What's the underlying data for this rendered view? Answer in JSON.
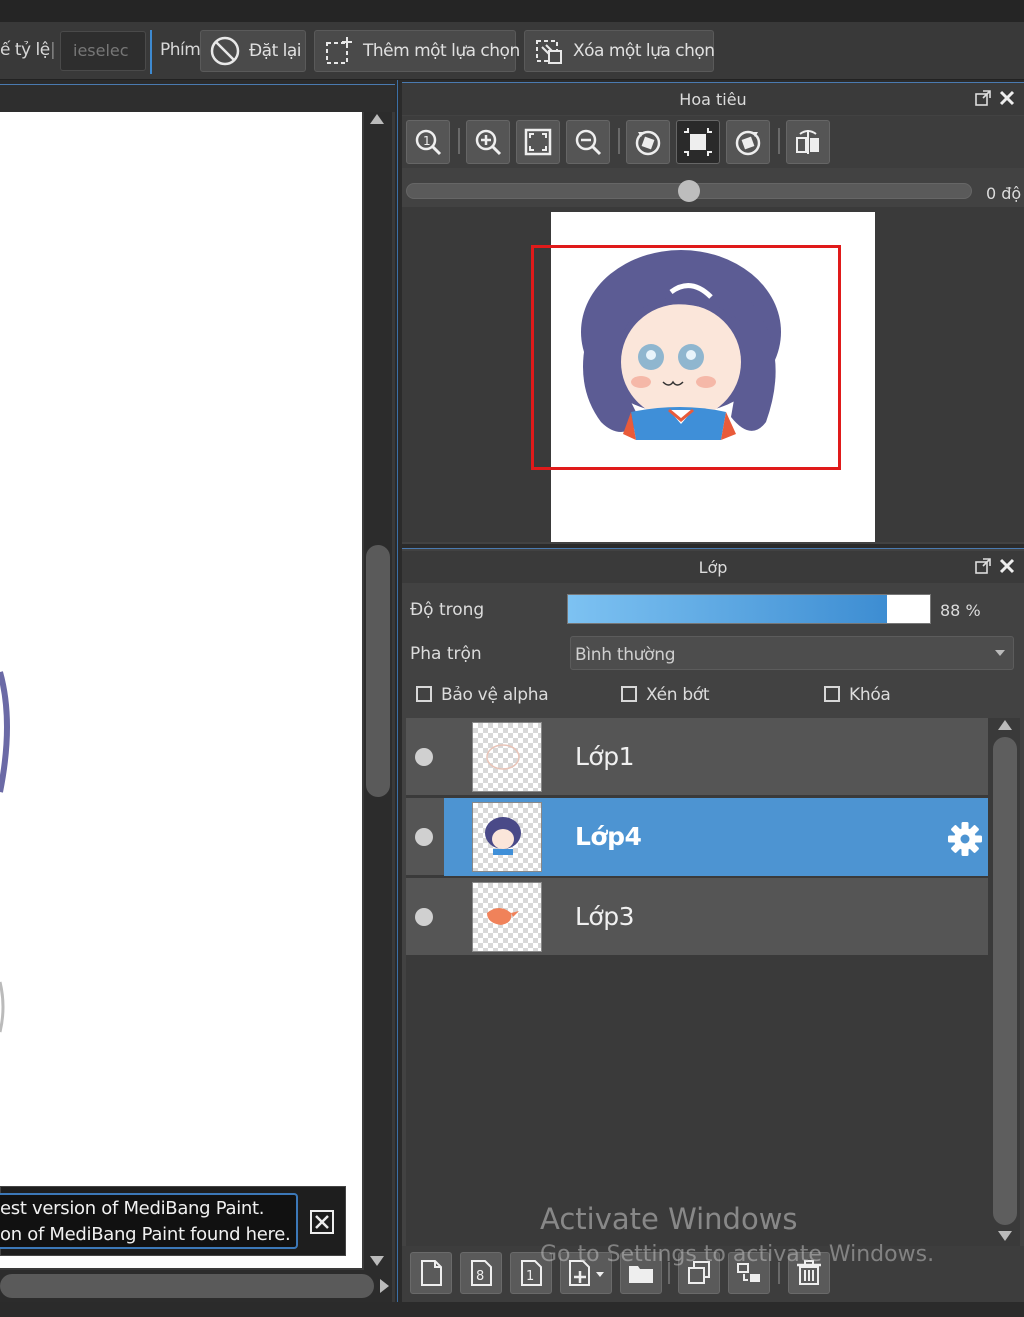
{
  "toolbar": {
    "ratio_label": "ế tỷ lệ",
    "ratio_sep": "|",
    "deselect_placeholder": "ieselec",
    "key_label": "Phím",
    "reset_label": "Đặt lại",
    "add_selection_label": "Thêm một lựa chọn",
    "remove_selection_label": "Xóa một lựa chọn"
  },
  "notification": {
    "line1": "est version of MediBang Paint.",
    "line2": "on of MediBang Paint found here."
  },
  "navigator": {
    "title": "Hoa tiêu",
    "angle": "0 độ",
    "rotation_fraction": 0.49
  },
  "layers": {
    "title": "Lớp",
    "opacity_label": "Độ trong",
    "opacity_value": "88 %",
    "opacity_fraction": 0.88,
    "blend_label": "Pha trộn",
    "blend_value": "Bình thường",
    "protect_alpha_label": "Bảo vệ alpha",
    "clip_label": "Xén bớt",
    "lock_label": "Khóa",
    "items": [
      {
        "name": "Lớp1",
        "selected": false
      },
      {
        "name": "Lớp4",
        "selected": true
      },
      {
        "name": "Lớp3",
        "selected": false
      }
    ]
  },
  "watermark": {
    "line1": "Activate Windows",
    "line2": "Go to Settings to activate Windows."
  },
  "colors": {
    "accent": "#4d94d2",
    "selection_rect": "#e01a1a",
    "panel_bg": "#424242"
  }
}
